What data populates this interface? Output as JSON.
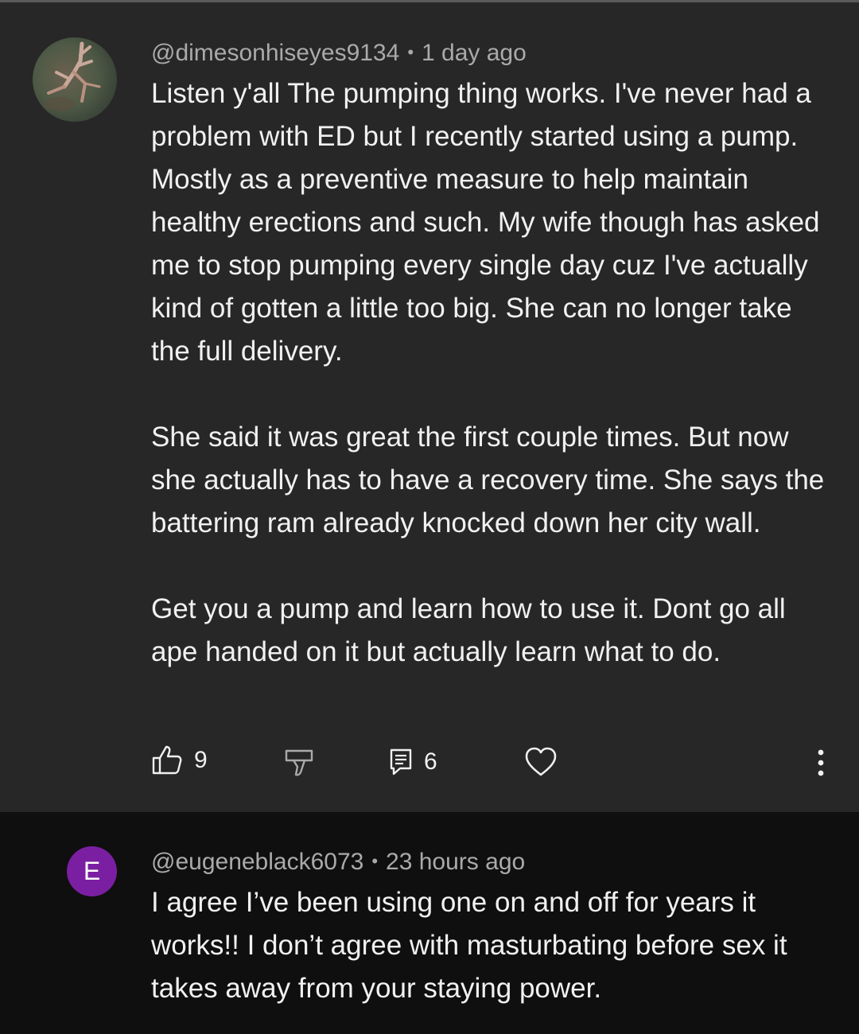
{
  "comments": [
    {
      "author": "@dimesonhiseyes9134",
      "time": "1 day ago",
      "paragraphs": [
        "Listen y'all The pumping thing works. I've never had a problem with ED but I recently started using a pump. Mostly as a preventive measure to help maintain healthy erections and such. My wife though has asked me to stop pumping every single day cuz I've actually kind of gotten a little too big. She can no longer take the full delivery.",
        "She said it was great the first couple times. But now she actually has to have a recovery time. She says the battering ram already knocked down her city wall.",
        "Get you a pump and learn how to use it. Dont go all ape handed on it but actually learn what to do."
      ],
      "likes": "9",
      "replies": "6",
      "icons": [
        "thumbs-up-icon",
        "thumbs-down-icon",
        "reply-icon",
        "heart-icon",
        "more-vert-icon"
      ]
    },
    {
      "author": "@eugeneblack6073",
      "time": "23 hours ago",
      "avatar_letter": "E",
      "avatar_color": "#7b1fa2",
      "paragraphs": [
        "I agree I’ve been using one on and off for years it works!! I don’t agree with masturbating before sex it takes away from your staying power."
      ]
    }
  ],
  "colors": {
    "background": "#0f0f0f",
    "highlight_background": "#272727",
    "text_primary": "#f1f1f1",
    "text_secondary": "#aaaaaa"
  }
}
